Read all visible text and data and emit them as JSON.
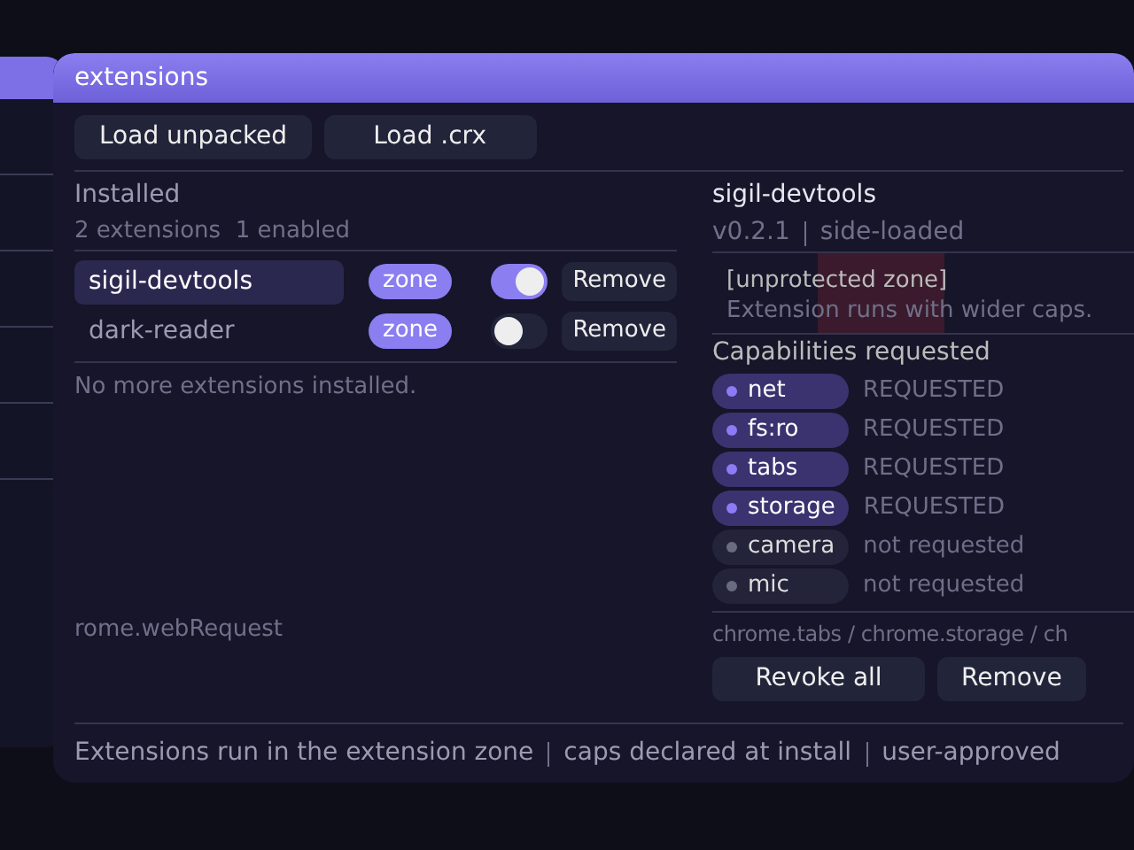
{
  "window": {
    "title": "extensions"
  },
  "toolbar": [
    "Load unpacked",
    "Load .crx"
  ],
  "installed": {
    "heading": "Installed",
    "summary": "2 extensions  1 enabled",
    "items": [
      {
        "name": "sigil-devtools",
        "selected": true,
        "zone": "zone",
        "enabled": true,
        "remove": "Remove"
      },
      {
        "name": "dark-reader",
        "selected": false,
        "zone": "zone",
        "enabled": false,
        "remove": "Remove"
      }
    ],
    "empty_note": "No more extensions installed.",
    "cut_text": "rome.webRequest"
  },
  "detail": {
    "title": "sigil-devtools",
    "version": "v0.2.1",
    "source": "side-loaded",
    "warning_title": "[unprotected zone]",
    "warning_text": "Extension runs with wider caps.",
    "caps_heading": "Capabilities requested",
    "capabilities": [
      {
        "name": "net",
        "requested": true,
        "status": "REQUESTED"
      },
      {
        "name": "fs:ro",
        "requested": true,
        "status": "REQUESTED"
      },
      {
        "name": "tabs",
        "requested": true,
        "status": "REQUESTED"
      },
      {
        "name": "storage",
        "requested": true,
        "status": "REQUESTED"
      },
      {
        "name": "camera",
        "requested": false,
        "status": "not requested"
      },
      {
        "name": "mic",
        "requested": false,
        "status": "not requested"
      }
    ],
    "apis": "chrome.tabs / chrome.storage / ch",
    "buttons": [
      "Revoke all",
      "Remove"
    ]
  },
  "status_bar": [
    "Extensions run in the extension zone",
    "caps declared at install",
    "user-approved"
  ]
}
